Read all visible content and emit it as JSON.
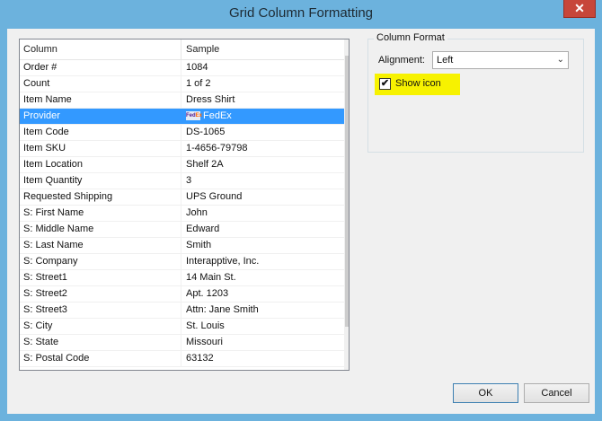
{
  "window": {
    "title": "Grid Column Formatting"
  },
  "grid": {
    "headers": [
      "Column",
      "Sample"
    ],
    "rows": [
      {
        "column": "Order #",
        "sample": "1084"
      },
      {
        "column": "Count",
        "sample": "1 of 2"
      },
      {
        "column": "Item Name",
        "sample": "Dress Shirt"
      },
      {
        "column": "Provider",
        "sample": "FedEx",
        "selected": true
      },
      {
        "column": "Item Code",
        "sample": "DS-1065"
      },
      {
        "column": "Item SKU",
        "sample": "1-4656-79798"
      },
      {
        "column": "Item Location",
        "sample": "Shelf 2A"
      },
      {
        "column": "Item Quantity",
        "sample": "3"
      },
      {
        "column": "Requested Shipping",
        "sample": "UPS Ground"
      },
      {
        "column": "S: First Name",
        "sample": "John"
      },
      {
        "column": "S: Middle Name",
        "sample": "Edward"
      },
      {
        "column": "S: Last Name",
        "sample": "Smith"
      },
      {
        "column": "S: Company",
        "sample": "Interapptive, Inc."
      },
      {
        "column": "S: Street1",
        "sample": "14 Main St."
      },
      {
        "column": "S: Street2",
        "sample": "Apt. 1203"
      },
      {
        "column": "S: Street3",
        "sample": "Attn: Jane Smith"
      },
      {
        "column": "S: City",
        "sample": "St. Louis"
      },
      {
        "column": "S: State",
        "sample": "Missouri"
      },
      {
        "column": "S: Postal Code",
        "sample": "63132"
      }
    ]
  },
  "column_format": {
    "legend": "Column Format",
    "alignment_label": "Alignment:",
    "alignment_value": "Left",
    "show_icon_label": "Show icon",
    "show_icon_checked": true
  },
  "buttons": {
    "ok": "OK",
    "cancel": "Cancel"
  },
  "icons": {
    "close": "close-icon",
    "provider_logo": "fedex-logo-icon",
    "scroll_up": "chevron-up-icon",
    "scroll_down": "chevron-down-icon",
    "dropdown": "chevron-down-icon"
  }
}
